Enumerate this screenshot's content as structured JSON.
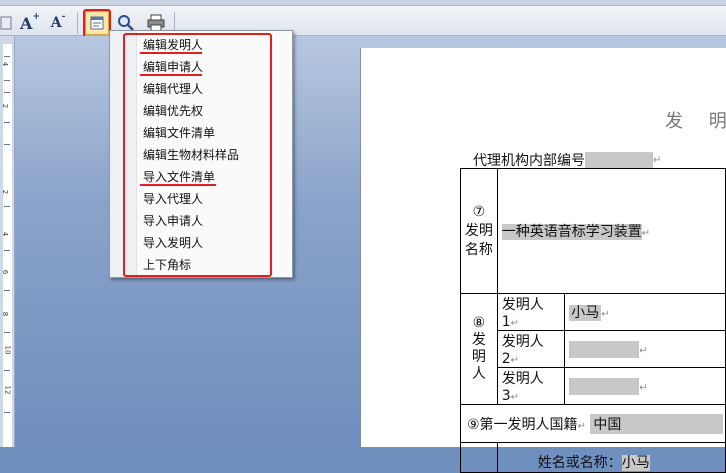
{
  "toolbar": {
    "icons": [
      "increase-font-icon",
      "decrease-font-icon",
      "edit-form-icon",
      "magnifier-icon",
      "print-icon"
    ],
    "grow_label": "A",
    "shrink_label": "A"
  },
  "menu": {
    "items": [
      {
        "label": "编辑发明人",
        "highlighted": true
      },
      {
        "label": "编辑申请人",
        "highlighted": true
      },
      {
        "label": "编辑代理人",
        "highlighted": false
      },
      {
        "label": "编辑优先权",
        "highlighted": false
      },
      {
        "label": "编辑文件清单",
        "highlighted": false
      },
      {
        "label": "编辑生物材料样品",
        "highlighted": false
      },
      {
        "label": "导入文件清单",
        "highlighted": true
      },
      {
        "label": "导入代理人",
        "highlighted": false
      },
      {
        "label": "导入申请人",
        "highlighted": false
      },
      {
        "label": "导入发明人",
        "highlighted": false
      },
      {
        "label": "上下角标",
        "highlighted": false
      }
    ]
  },
  "ruler": {
    "numbers": [
      "4",
      "2",
      "2",
      "4",
      "6",
      "8",
      "10",
      "12"
    ]
  },
  "document": {
    "title": "发 明",
    "agency_label": "代理机构内部编号",
    "invention_name_label": "⑦发明名称",
    "invention_name_num": "⑦",
    "invention_name_word": "发明名称",
    "invention_name_value": "一种英语音标学习装置",
    "inventor_section_num": "⑧",
    "inventor_section_word": "发明人",
    "inventors": [
      {
        "label": "发明人 1",
        "value": "小马"
      },
      {
        "label": "发明人 2",
        "value": ""
      },
      {
        "label": "发明人 3",
        "value": ""
      }
    ],
    "nationality_label": "⑨第一发明人国籍",
    "nationality_value": "中国",
    "name_label": "姓名或名称：",
    "name_value": "小马"
  },
  "colors": {
    "annotation": "#e0201c",
    "field_highlight": "#c8c8c8"
  }
}
